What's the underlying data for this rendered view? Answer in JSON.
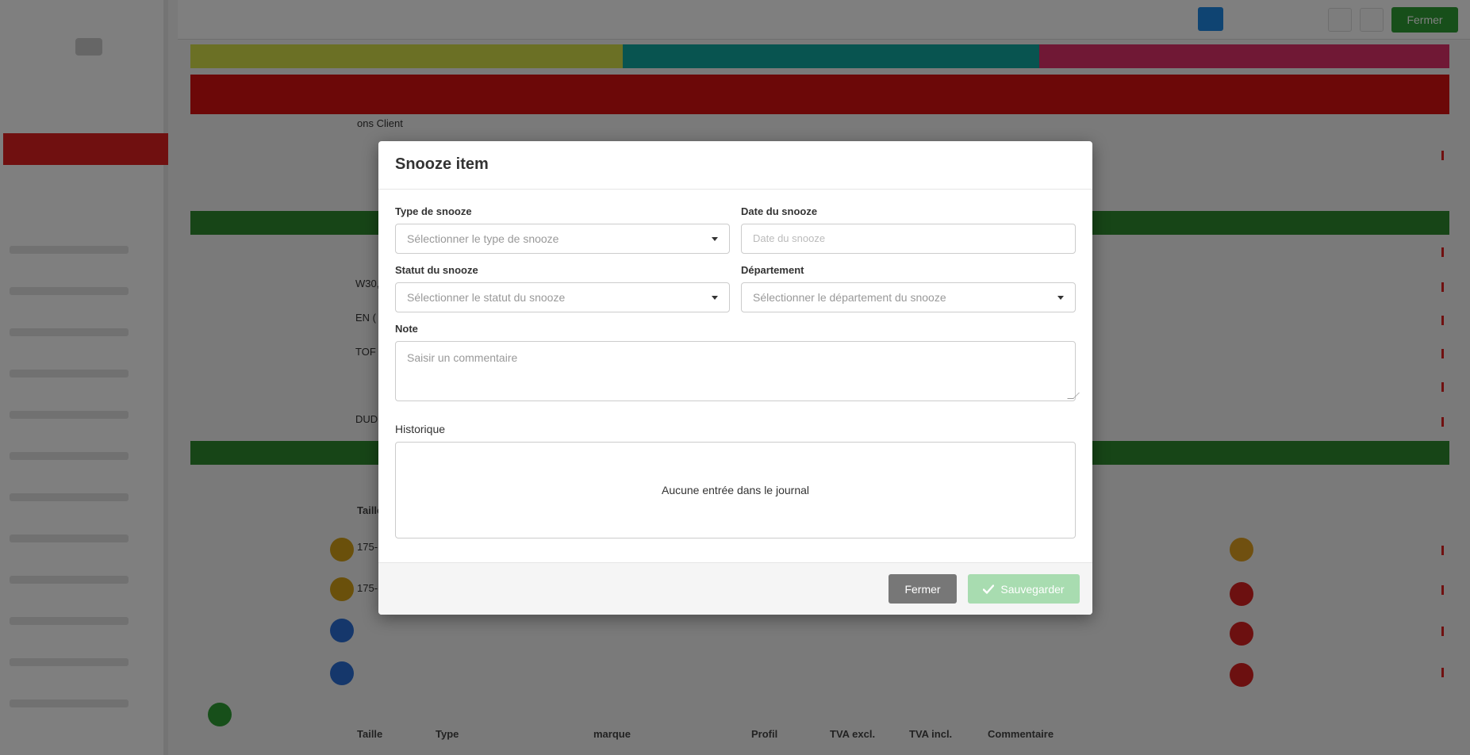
{
  "modal": {
    "title": "Snooze item",
    "fields": {
      "snooze_type": {
        "label": "Type de snooze",
        "placeholder": "Sélectionner le type de snooze"
      },
      "snooze_date": {
        "label": "Date du snooze",
        "placeholder": "Date du snooze"
      },
      "snooze_status": {
        "label": "Statut du snooze",
        "placeholder": "Sélectionner le statut du snooze"
      },
      "department": {
        "label": "Département",
        "placeholder": "Sélectionner le département du snooze"
      },
      "note": {
        "label": "Note",
        "placeholder": "Saisir un commentaire"
      }
    },
    "history": {
      "label": "Historique",
      "empty_text": "Aucune entrée dans le journal"
    },
    "footer": {
      "close_label": "Fermer",
      "save_label": "Sauvegarder",
      "save_icon": "check-icon"
    }
  },
  "background": {
    "topbar_close_label": "Fermer",
    "subheader_text": "ons Client",
    "row_fragments": [
      "W30,",
      "EN (",
      "TOF",
      "DUD"
    ],
    "table_headers_1": [
      "Taille"
    ],
    "table_cells": [
      "175-",
      "175-"
    ],
    "table_headers_2": [
      "Taille",
      "Type",
      "marque",
      "Profil",
      "TVA excl.",
      "TVA incl.",
      "Commentaire"
    ]
  },
  "colors": {
    "save_button_disabled": "#a8dcb0",
    "close_button": "#777777",
    "overlay": "rgba(0,0,0,0.5)"
  }
}
